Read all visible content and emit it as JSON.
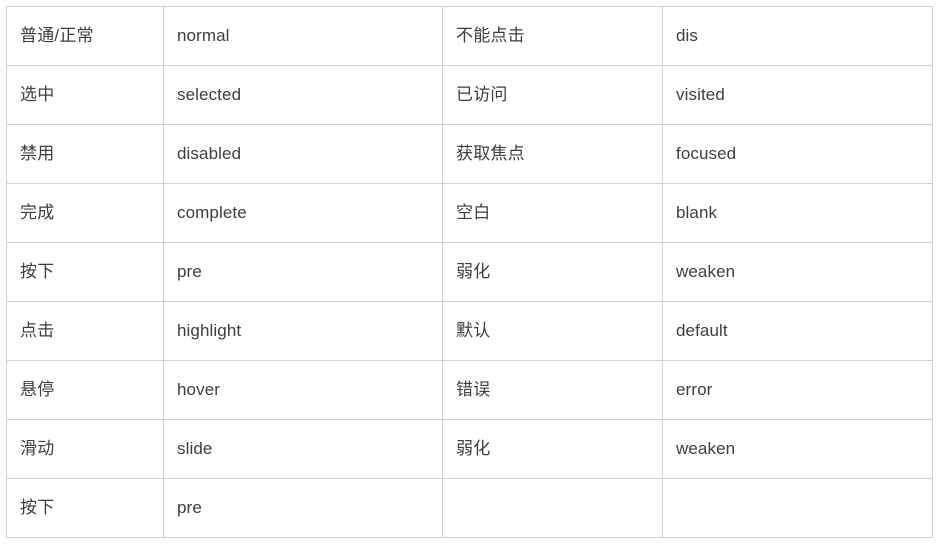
{
  "table": {
    "name": "ui-state-terminology-table",
    "border_color": "#d1d1d1",
    "text_color": "#3c4043",
    "background": "#ffffff",
    "column_count": 4,
    "row_count": 9,
    "rows": [
      {
        "cn_left": "普通/正常",
        "en_left": "normal",
        "cn_right": "不能点击",
        "en_right": "dis"
      },
      {
        "cn_left": "选中",
        "en_left": "selected",
        "cn_right": "已访问",
        "en_right": "visited"
      },
      {
        "cn_left": "禁用",
        "en_left": "disabled",
        "cn_right": "获取焦点",
        "en_right": "focused"
      },
      {
        "cn_left": "完成",
        "en_left": "complete",
        "cn_right": "空白",
        "en_right": "blank"
      },
      {
        "cn_left": "按下",
        "en_left": "pre",
        "cn_right": "弱化",
        "en_right": "weaken"
      },
      {
        "cn_left": "点击",
        "en_left": "highlight",
        "cn_right": "默认",
        "en_right": "default"
      },
      {
        "cn_left": "悬停",
        "en_left": "hover",
        "cn_right": "错误",
        "en_right": "error"
      },
      {
        "cn_left": "滑动",
        "en_left": "slide",
        "cn_right": "弱化",
        "en_right": "weaken"
      },
      {
        "cn_left": "按下",
        "en_left": "pre",
        "cn_right": "",
        "en_right": ""
      }
    ]
  }
}
